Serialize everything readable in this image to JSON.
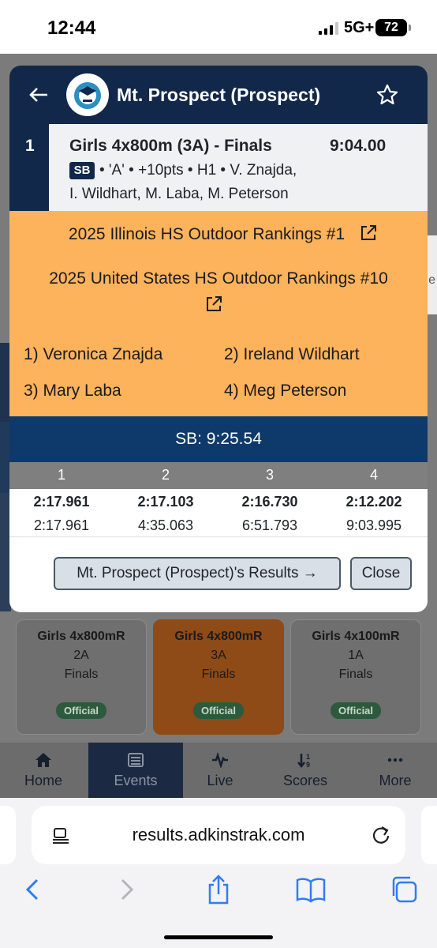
{
  "status_bar": {
    "time": "12:44",
    "network": "5G+",
    "battery": "72"
  },
  "modal": {
    "title": "Mt. Prospect (Prospect)",
    "result": {
      "place": "1",
      "event": "Girls 4x800m (3A) - Finals",
      "mark": "9:04.00",
      "sb_tag": "SB",
      "detail_line1": "• 'A' • +10pts • H1 • V. Znajda,",
      "detail_line2": "I. Wildhart, M. Laba, M. Peterson"
    },
    "rankings": [
      "2025 Illinois HS Outdoor Rankings #1",
      "2025 United States HS Outdoor Rankings #10"
    ],
    "athletes": [
      "1) Veronica Znajda",
      "2) Ireland Wildhart",
      "3) Mary Laba",
      "4) Meg Peterson"
    ],
    "season_best": "SB: 9:25.54",
    "splits": {
      "headers": [
        "1",
        "2",
        "3",
        "4"
      ],
      "lap": [
        "2:17.961",
        "2:17.103",
        "2:16.730",
        "2:12.202"
      ],
      "cumulative": [
        "2:17.961",
        "4:35.063",
        "6:51.793",
        "9:03.995"
      ]
    },
    "results_button": "Mt. Prospect (Prospect)'s Results →",
    "close_button": "Close"
  },
  "event_cards": [
    {
      "title": "Girls 4x800mR",
      "class": "2A",
      "round": "Finals",
      "status": "Official"
    },
    {
      "title": "Girls 4x800mR",
      "class": "3A",
      "round": "Finals",
      "status": "Official"
    },
    {
      "title": "Girls 4x100mR",
      "class": "1A",
      "round": "Finals",
      "status": "Official"
    }
  ],
  "bottom_nav": [
    {
      "label": "Home",
      "icon": "home-icon"
    },
    {
      "label": "Events",
      "icon": "list-icon"
    },
    {
      "label": "Live",
      "icon": "pulse-icon"
    },
    {
      "label": "Scores",
      "icon": "sort-icon"
    },
    {
      "label": "More",
      "icon": "more-icon"
    }
  ],
  "browser": {
    "url": "results.adkinstrak.com"
  },
  "colors": {
    "navy": "#12284b",
    "orange": "#fdb25c",
    "sb_blue": "#0e3a6b",
    "active_card": "#8e4a17"
  }
}
